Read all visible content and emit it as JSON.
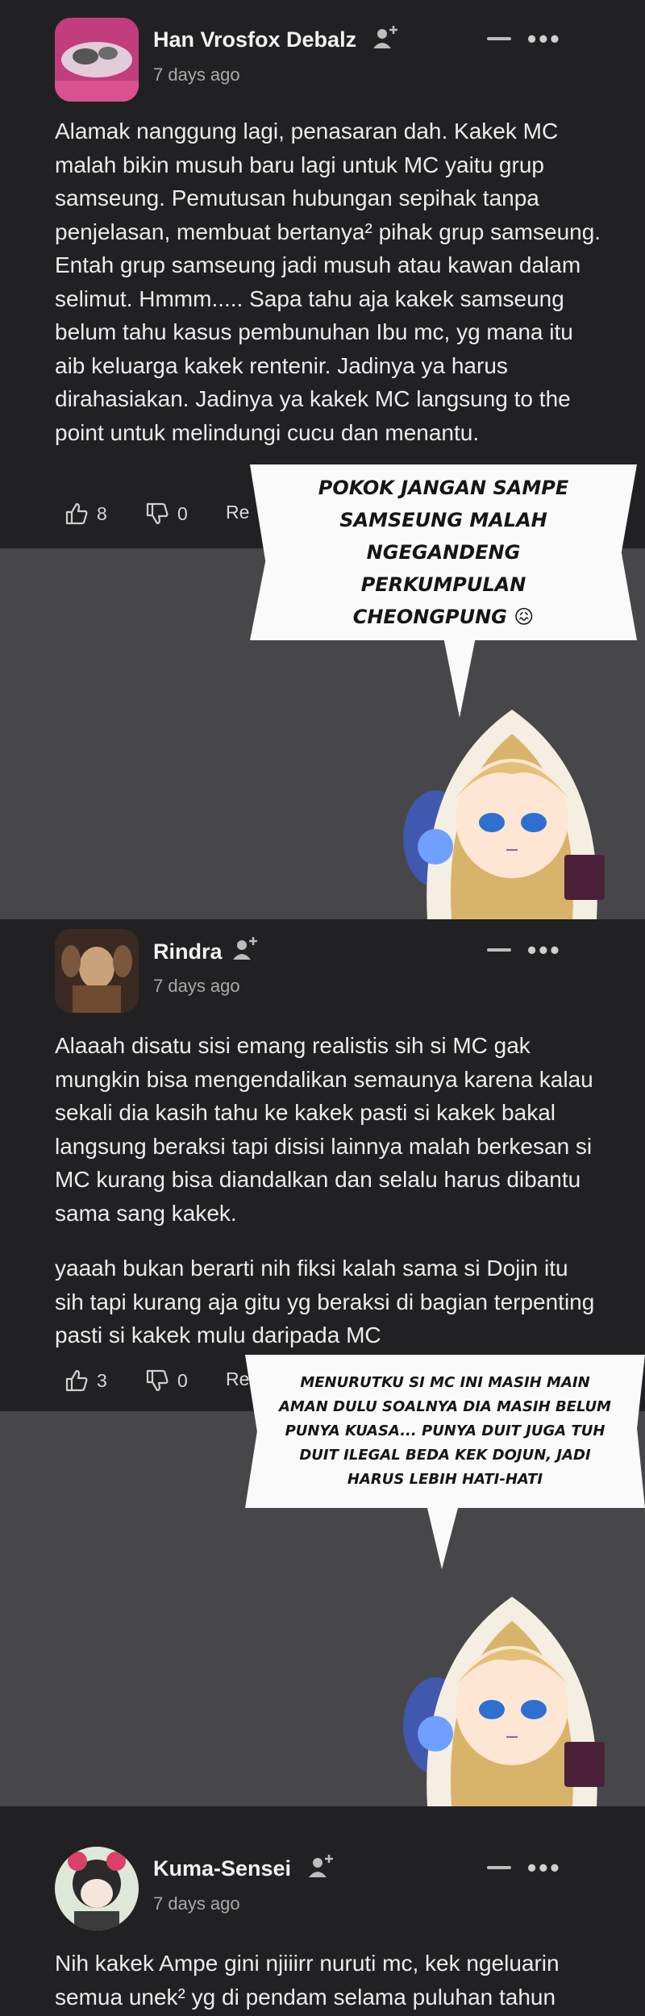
{
  "comments": [
    {
      "username": "Han Vrosfox Debalz",
      "time": "7 days ago",
      "body": "Alamak nanggung lagi, penasaran dah. Kakek MC malah bikin musuh baru lagi untuk MC yaitu grup samseung. Pemutusan hubungan sepihak tanpa penjelasan, membuat bertanya² pihak grup samseung. Entah grup samseung jadi musuh atau kawan dalam selimut. Hmmm..... Sapa tahu aja kakek samseung belum tahu kasus pembunuhan Ibu mc, yg mana itu aib keluarga kakek rentenir. Jadinya ya harus dirahasiakan. Jadinya ya kakek MC langsung to the point untuk melindungi cucu dan menantu.",
      "likes": "8",
      "dislikes": "0",
      "reply_label": "Re"
    },
    {
      "username": "Rindra",
      "time": "7 days ago",
      "body": "Alaaah disatu sisi emang realistis sih si MC gak mungkin bisa mengendalikan semaunya karena kalau sekali dia kasih tahu ke kakek pasti si kakek bakal langsung beraksi tapi disisi lainnya malah berkesan si MC kurang bisa diandalkan dan selalu harus dibantu sama sang kakek.",
      "body2": "yaaah bukan berarti nih fiksi kalah sama si Dojin itu sih tapi kurang aja gitu yg beraksi di bagian terpenting pasti si kakek mulu daripada MC",
      "likes": "3",
      "dislikes": "0",
      "reply_label": "Re"
    },
    {
      "username": "Kuma-Sensei",
      "time": "7 days ago",
      "body": "Nih kakek Ampe gini njiiirr nuruti mc, kek ngeluarin semua unek² yg di pendam selama puluhan tahun"
    }
  ],
  "stickers": [
    {
      "text": "POKOK JANGAN SAMPE SAMSEUNG MALAH NGEGANDENG PERKUMPULAN CHEONGPUNG 😖"
    },
    {
      "text": "MENURUTKU SI MC INI MASIH MAIN AMAN DULU SOALNYA DIA MASIH BELUM PUNYA KUASA... PUNYA DUIT JUGA TUH DUIT ILEGAL BEDA KEK DOJUN, JADI HARUS LEBIH HATI-HATI"
    }
  ],
  "icons": {
    "follow": "add-user-icon",
    "like": "thumbs-up-icon",
    "dislike": "thumbs-down-icon",
    "more": "more-horizontal-icon",
    "collapse": "minus-icon"
  }
}
